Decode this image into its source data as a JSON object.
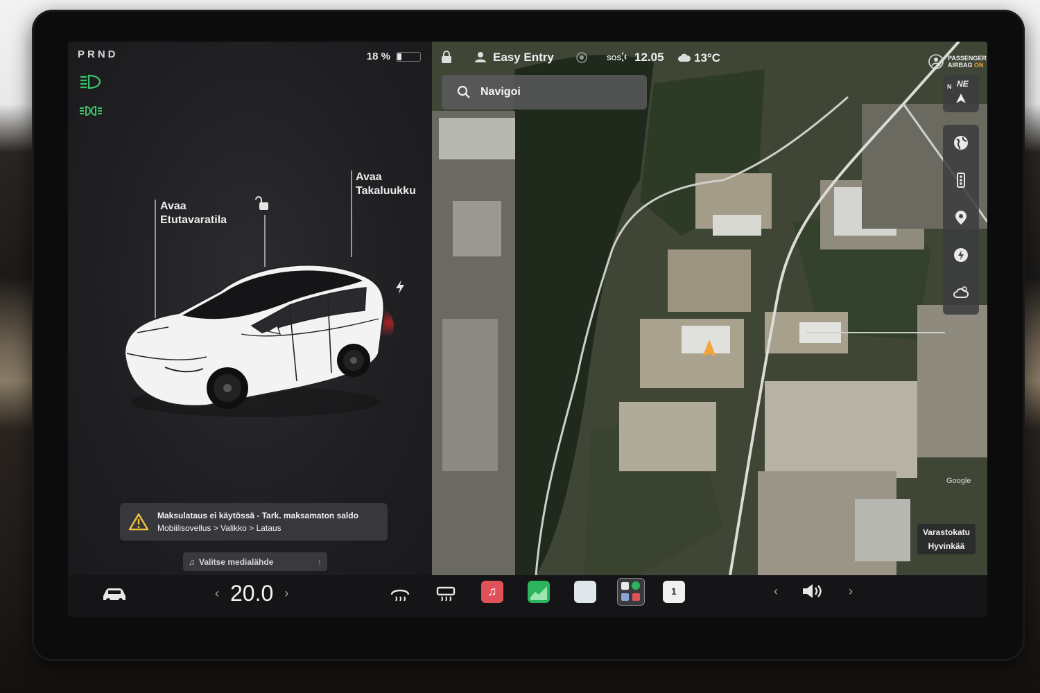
{
  "drive": {
    "gears": "PRND"
  },
  "battery": {
    "percent_label": "18 %",
    "level": 0.18
  },
  "car_panel": {
    "frunk_callout": {
      "line1": "Avaa",
      "line2": "Etutavaratila"
    },
    "trunk_callout": {
      "line1": "Avaa",
      "line2": "Takaluukku"
    },
    "icons": [
      "headlights-icon",
      "parking-lights-icon",
      "lock-open-icon",
      "charge-port-icon"
    ]
  },
  "alert": {
    "title": "Maksulataus ei käytössä - Tark. maksamaton saldo",
    "path": "Mobiilisovellus > Valikko > Lataus"
  },
  "media": {
    "label": "Valitse medialähde"
  },
  "status_bar": {
    "profile": "Easy Entry",
    "sos": "SOS",
    "time": "12.05",
    "temperature": "13°C",
    "airbag_line1": "PASSENGER",
    "airbag_line2": "AIRBAG",
    "airbag_state": "ON"
  },
  "map": {
    "search_placeholder": "Navigoi",
    "compass": {
      "heading_label": "NE",
      "north_label": "N"
    },
    "street": {
      "line1": "Varastokatu",
      "line2": "Hyvinkää"
    },
    "attribution": "Google"
  },
  "bottom_bar": {
    "temperature_value": "20.0",
    "left_arrow": "‹",
    "right_arrow": "›",
    "calendar_day": "1"
  },
  "colors": {
    "green_icon": "#3ec26a",
    "accent_orange": "#f2a33a",
    "music_red": "#e0525a",
    "chart_green": "#2bb45c"
  }
}
